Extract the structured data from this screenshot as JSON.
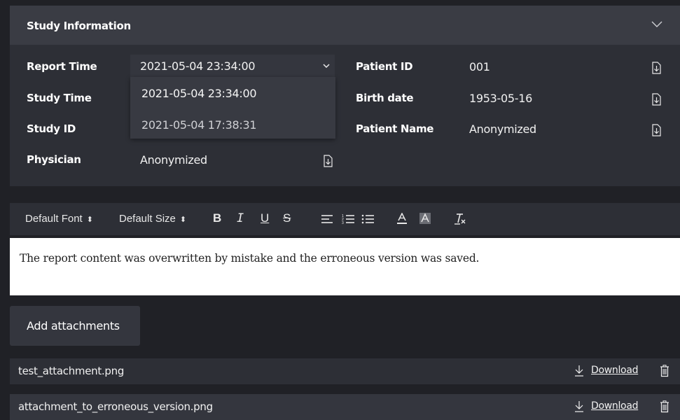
{
  "study_info": {
    "title": "Study Information",
    "report_time_label": "Report Time",
    "report_time_value": "2021-05-04 23:34:00",
    "report_time_options": [
      "2021-05-04 23:34:00",
      "2021-05-04 17:38:31"
    ],
    "study_time_label": "Study Time",
    "study_id_label": "Study ID",
    "physician_label": "Physician",
    "physician_value": "Anonymized",
    "patient_id_label": "Patient ID",
    "patient_id_value": "001",
    "birth_date_label": "Birth date",
    "birth_date_value": "1953-05-16",
    "patient_name_label": "Patient Name",
    "patient_name_value": "Anonymized"
  },
  "toolbar": {
    "font_label": "Default Font",
    "size_label": "Default Size",
    "bold": "B",
    "italic": "I",
    "underline": "U",
    "strike": "S",
    "icons": [
      "align-icon",
      "ordered-list-icon",
      "bullet-list-icon",
      "text-color-icon",
      "highlight-icon",
      "clear-format-icon"
    ]
  },
  "editor": {
    "content": "The report content was overwritten by mistake and the erroneous version was saved."
  },
  "attachments": {
    "add_label": "Add attachments",
    "files": [
      {
        "name": "test_attachment.png",
        "download_label": "Download"
      },
      {
        "name": "attachment_to_erroneous_version.png",
        "download_label": "Download"
      }
    ]
  },
  "colors": {
    "background": "#202126",
    "panel": "#2d2f36",
    "header": "#3a3c44",
    "editor": "#ffffff"
  }
}
